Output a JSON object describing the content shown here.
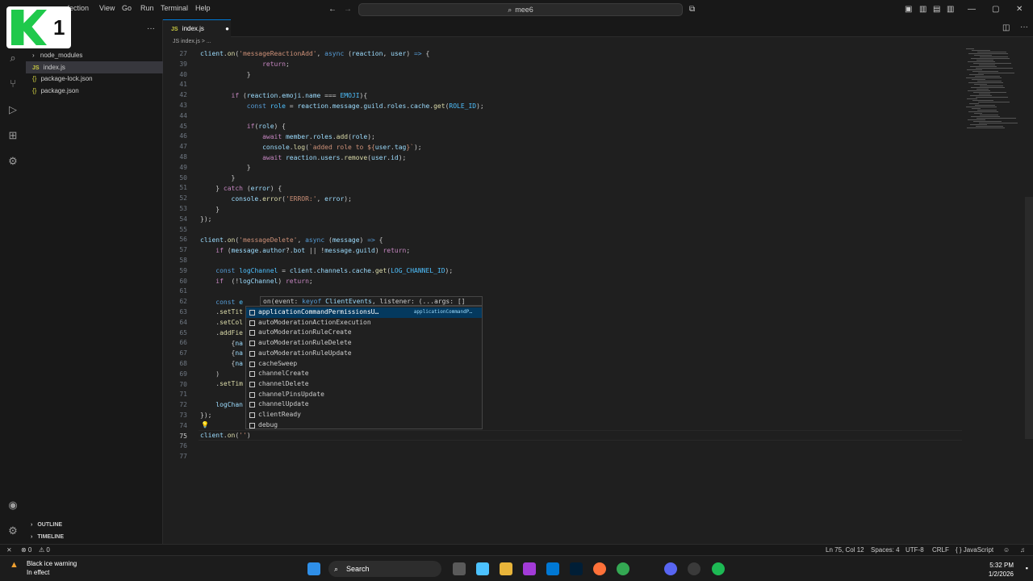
{
  "titlebar": {
    "logo_text": "1",
    "menus": [
      "lection",
      "View",
      "Go",
      "Run",
      "Terminal",
      "Help"
    ],
    "search": "mee6"
  },
  "sidebar": {
    "items": [
      {
        "label": "node_modules",
        "type": "folder"
      },
      {
        "label": "index.js",
        "type": "js",
        "badge": "JS"
      },
      {
        "label": "package-lock.json",
        "type": "json",
        "badge": "{}"
      },
      {
        "label": "package.json",
        "type": "json",
        "badge": "{}"
      }
    ],
    "outline": "OUTLINE",
    "timeline": "TIMELINE"
  },
  "tab": {
    "badge": "JS",
    "label": "index.js",
    "dot": "●"
  },
  "breadcrumb": "JS index.js > ...",
  "editor": {
    "line_numbers": [
      "27",
      "39",
      "40",
      "41",
      "42",
      "43",
      "44",
      "45",
      "46",
      "47",
      "48",
      "49",
      "50",
      "51",
      "52",
      "53",
      "54",
      "55",
      "56",
      "57",
      "58",
      "59",
      "60",
      "61",
      "62",
      "63",
      "64",
      "65",
      "66",
      "67",
      "68",
      "69",
      "70",
      "71",
      "72",
      "73",
      "74",
      "75",
      "76",
      "77"
    ],
    "current_line": "75"
  },
  "hint": {
    "prefix": "on(event: ",
    "keyword": "keyof ",
    "type": "ClientEvents",
    "rest": ", listener: (...args: []"
  },
  "suggestions": [
    {
      "label": "applicationCommandPermissionsU…",
      "detail": "applicationCommandP…",
      "active": true
    },
    {
      "label": "autoModerationActionExecution"
    },
    {
      "label": "autoModerationRuleCreate"
    },
    {
      "label": "autoModerationRuleDelete"
    },
    {
      "label": "autoModerationRuleUpdate"
    },
    {
      "label": "cacheSweep"
    },
    {
      "label": "channelCreate"
    },
    {
      "label": "channelDelete"
    },
    {
      "label": "channelPinsUpdate"
    },
    {
      "label": "channelUpdate"
    },
    {
      "label": "clientReady"
    },
    {
      "label": "debug"
    }
  ],
  "statusbar": {
    "errors": "⊗ 0",
    "warnings": "⚠ 0",
    "position": "Ln 75, Col 12",
    "spaces": "Spaces: 4",
    "encoding": "UTF-8",
    "eol": "CRLF",
    "language": "{ } JavaScript"
  },
  "taskbar": {
    "weather_title": "Black ice warning",
    "weather_sub": "In effect",
    "search": "Search",
    "time": "5:32 PM",
    "date": "1/2/2026"
  },
  "colors": {
    "keyword": "#c586c0",
    "function": "#dcdcaa",
    "string": "#ce9178",
    "variable": "#9cdcfe",
    "accent": "#0078d4"
  }
}
